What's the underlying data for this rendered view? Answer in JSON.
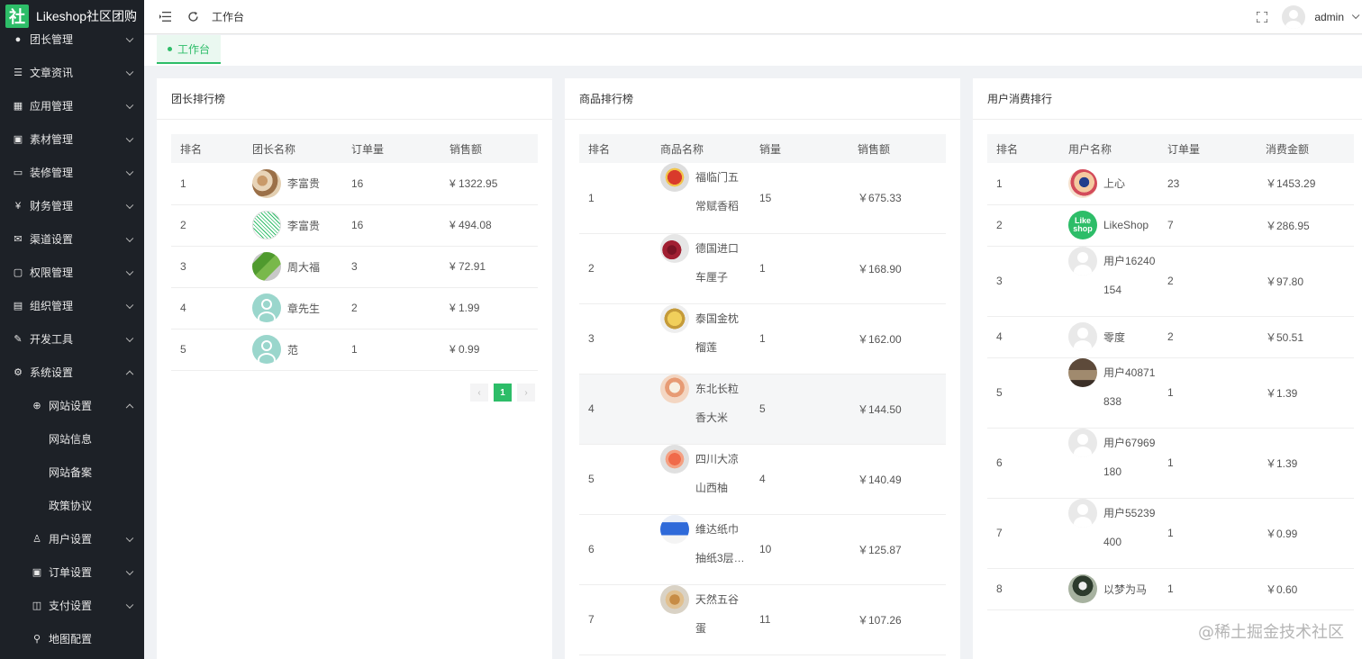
{
  "app": {
    "logo_char": "社",
    "title": "Likeshop社区团购"
  },
  "sidebar": {
    "items": [
      {
        "label": "团长管理",
        "icon": "user-icon",
        "glyph": "●",
        "expanded": false,
        "level": 1
      },
      {
        "label": "文章资讯",
        "icon": "article-icon",
        "glyph": "☰",
        "expanded": false,
        "level": 1
      },
      {
        "label": "应用管理",
        "icon": "apps-icon",
        "glyph": "▦",
        "expanded": false,
        "level": 1
      },
      {
        "label": "素材管理",
        "icon": "image-icon",
        "glyph": "▣",
        "expanded": false,
        "level": 1
      },
      {
        "label": "装修管理",
        "icon": "decoration-icon",
        "glyph": "▭",
        "expanded": false,
        "level": 1
      },
      {
        "label": "财务管理",
        "icon": "finance-icon",
        "glyph": "¥",
        "expanded": false,
        "level": 1
      },
      {
        "label": "渠道设置",
        "icon": "mail-icon",
        "glyph": "✉",
        "expanded": false,
        "level": 1
      },
      {
        "label": "权限管理",
        "icon": "lock-icon",
        "glyph": "▢",
        "expanded": false,
        "level": 1
      },
      {
        "label": "组织管理",
        "icon": "building-icon",
        "glyph": "▤",
        "expanded": false,
        "level": 1
      },
      {
        "label": "开发工具",
        "icon": "tool-icon",
        "glyph": "✎",
        "expanded": false,
        "level": 1
      },
      {
        "label": "系统设置",
        "icon": "gear-icon",
        "glyph": "⚙",
        "expanded": true,
        "level": 1
      },
      {
        "label": "网站设置",
        "icon": "globe-icon",
        "glyph": "⊕",
        "expanded": true,
        "level": 2
      },
      {
        "label": "网站信息",
        "level": 3
      },
      {
        "label": "网站备案",
        "level": 3
      },
      {
        "label": "政策协议",
        "level": 3
      },
      {
        "label": "用户设置",
        "icon": "user-settings-icon",
        "glyph": "♙",
        "expanded": false,
        "level": 2
      },
      {
        "label": "订单设置",
        "icon": "order-icon",
        "glyph": "▣",
        "expanded": false,
        "level": 2
      },
      {
        "label": "支付设置",
        "icon": "payment-icon",
        "glyph": "◫",
        "expanded": false,
        "level": 2
      },
      {
        "label": "地图配置",
        "icon": "map-pin-icon",
        "glyph": "⚲",
        "level": 2
      }
    ]
  },
  "header": {
    "breadcrumb": "工作台",
    "user": "admin"
  },
  "tagbar": {
    "active_tag": "工作台"
  },
  "colors": {
    "brand": "#2dbd68",
    "sidebar_bg": "#1d2127"
  },
  "leader_rank": {
    "title": "团长排行榜",
    "columns": [
      "排名",
      "团长名称",
      "订单量",
      "销售额"
    ],
    "rows": [
      {
        "rank": "1",
        "name": "李富贵",
        "orders": "16",
        "sales": "¥ 1322.95",
        "avatar": "peanut-photo"
      },
      {
        "rank": "2",
        "name": "李富贵",
        "orders": "16",
        "sales": "¥ 494.08",
        "avatar": "qr-photo"
      },
      {
        "rank": "3",
        "name": "周大福",
        "orders": "3",
        "sales": "¥ 72.91",
        "avatar": "cucumber-photo"
      },
      {
        "rank": "4",
        "name": "章先生",
        "orders": "2",
        "sales": "¥ 1.99",
        "avatar": "default-teal"
      },
      {
        "rank": "5",
        "name": "范",
        "orders": "1",
        "sales": "¥ 0.99",
        "avatar": "default-teal"
      }
    ],
    "pager": {
      "prev": "‹",
      "current": "1",
      "next": "›"
    }
  },
  "goods_rank": {
    "title": "商品排行榜",
    "columns": [
      "排名",
      "商品名称",
      "销量",
      "销售额"
    ],
    "rows": [
      {
        "rank": "1",
        "name1": "福临门五",
        "name2": "常赋香稻",
        "sales_count": "15",
        "sales": "￥675.33",
        "thumb": "rice-bag"
      },
      {
        "rank": "2",
        "name1": "德国进口",
        "name2": "车厘子",
        "sales_count": "1",
        "sales": "￥168.90",
        "thumb": "cherries"
      },
      {
        "rank": "3",
        "name1": "泰国金枕",
        "name2": "榴莲",
        "sales_count": "1",
        "sales": "￥162.00",
        "thumb": "durian"
      },
      {
        "rank": "4",
        "name1": "东北长粒",
        "name2": "香大米",
        "sales_count": "5",
        "sales": "￥144.50",
        "thumb": "rice"
      },
      {
        "rank": "5",
        "name1": "四川大凉",
        "name2": "山西柚",
        "sales_count": "4",
        "sales": "￥140.49",
        "thumb": "grapefruit"
      },
      {
        "rank": "6",
        "name1": "维达纸巾",
        "name2": "抽纸3层…",
        "sales_count": "10",
        "sales": "￥125.87",
        "thumb": "tissue"
      },
      {
        "rank": "7",
        "name1": "天然五谷",
        "name2": "蛋",
        "sales_count": "11",
        "sales": "￥107.26",
        "thumb": "eggs"
      }
    ]
  },
  "user_rank": {
    "title": "用户消费排行",
    "columns": [
      "排名",
      "用户名称",
      "订单量",
      "消费金额"
    ],
    "rows": [
      {
        "rank": "1",
        "name1": "上心",
        "name2": "",
        "orders": "23",
        "amount": "￥1453.29",
        "avatar": "cartoon"
      },
      {
        "rank": "2",
        "name1": "LikeShop",
        "name2": "",
        "orders": "7",
        "amount": "￥286.95",
        "avatar": "likeshop-logo"
      },
      {
        "rank": "3",
        "name1": "用户16240",
        "name2": "154",
        "orders": "2",
        "amount": "￥97.80",
        "avatar": "default"
      },
      {
        "rank": "4",
        "name1": "零度",
        "name2": "",
        "orders": "2",
        "amount": "￥50.51",
        "avatar": "default"
      },
      {
        "rank": "5",
        "name1": "用户40871",
        "name2": "838",
        "orders": "1",
        "amount": "￥1.39",
        "avatar": "photo-dark"
      },
      {
        "rank": "6",
        "name1": "用户67969",
        "name2": "180",
        "orders": "1",
        "amount": "￥1.39",
        "avatar": "default"
      },
      {
        "rank": "7",
        "name1": "用户55239",
        "name2": "400",
        "orders": "1",
        "amount": "￥0.99",
        "avatar": "default"
      },
      {
        "rank": "8",
        "name1": "以梦为马",
        "name2": "",
        "orders": "1",
        "amount": "￥0.60",
        "avatar": "photo-person"
      }
    ]
  },
  "watermark": "@稀土掘金技术社区"
}
